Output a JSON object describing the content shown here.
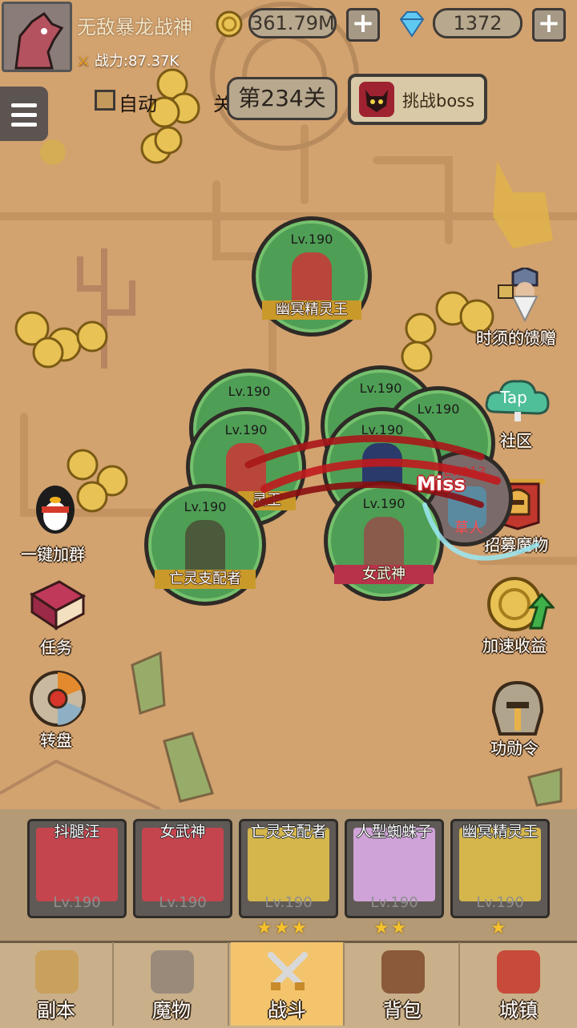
{
  "player": {
    "name": "无敌暴龙战神",
    "power": "战力:87.37K"
  },
  "currency": {
    "gold": "361.79M",
    "gems": "1372",
    "add_symbol": "+"
  },
  "stage": {
    "auto_label": "自动",
    "auto_suffix": "关",
    "level": "第234关",
    "boss_button": "挑战boss"
  },
  "side_left": [
    {
      "label": "一键加群",
      "icon": "penguin-icon"
    },
    {
      "label": "任务",
      "icon": "book-icon"
    },
    {
      "label": "转盘",
      "icon": "wheel-icon"
    }
  ],
  "side_right": [
    {
      "label": "时须的馈赠",
      "icon": "dwarf-icon"
    },
    {
      "label": "社区",
      "icon": "tap-cloud-icon",
      "badge": "Tap"
    },
    {
      "label": "招募魔物",
      "icon": "banner-helmet-icon"
    },
    {
      "label": "加速收益",
      "icon": "coin-arrow-icon"
    },
    {
      "label": "功勋令",
      "icon": "helmet-icon"
    }
  ],
  "battle": {
    "heroes": [
      {
        "lv": "Lv.190",
        "name": "幽冥精灵王",
        "color": "#b8463a"
      },
      {
        "lv": "Lv.190",
        "name": "",
        "color": "#6a5a4a"
      },
      {
        "lv": "Lv.190",
        "name": "",
        "color": "#5a4a7a"
      },
      {
        "lv": "Lv.190",
        "name": "",
        "color": "#6a6a7a"
      },
      {
        "lv": "Lv.190",
        "name": "灵王",
        "color": "#b8463a"
      },
      {
        "lv": "Lv.190",
        "name": "",
        "color": "#2a3a6a"
      },
      {
        "lv": "Lv.190",
        "name": "亡灵支配者",
        "color": "#4a5a3a"
      },
      {
        "lv": "Lv.190",
        "name": "女武神",
        "color": "#8a5a4a"
      }
    ],
    "enemy": {
      "lv": "Lv.213",
      "name": "草人"
    },
    "miss_text": "Miss"
  },
  "party": [
    {
      "name": "抖腿汪",
      "lv": "Lv.190",
      "stars": "",
      "bg": "#c4454e"
    },
    {
      "name": "女武神",
      "lv": "Lv.190",
      "stars": "",
      "bg": "#c4454e"
    },
    {
      "name": "亡灵支配者",
      "lv": "Lv.190",
      "stars": "★★★",
      "bg": "#d4b64c"
    },
    {
      "name": "人型蜘蛛子",
      "lv": "Lv.190",
      "stars": "★★",
      "bg": "#cfa3d8"
    },
    {
      "name": "幽冥精灵王",
      "lv": "Lv.190",
      "stars": "★",
      "bg": "#d4b64c"
    }
  ],
  "nav": [
    {
      "label": "副本",
      "icon": "map-icon",
      "color": "#c9a05c"
    },
    {
      "label": "魔物",
      "icon": "helmet-icon",
      "color": "#9a8a7a"
    },
    {
      "label": "战斗",
      "icon": "crossed-swords-icon",
      "color": "#e0e0e0",
      "active": true
    },
    {
      "label": "背包",
      "icon": "backpack-icon",
      "color": "#8a5a3a"
    },
    {
      "label": "城镇",
      "icon": "shop-icon",
      "color": "#c84a3a"
    }
  ]
}
